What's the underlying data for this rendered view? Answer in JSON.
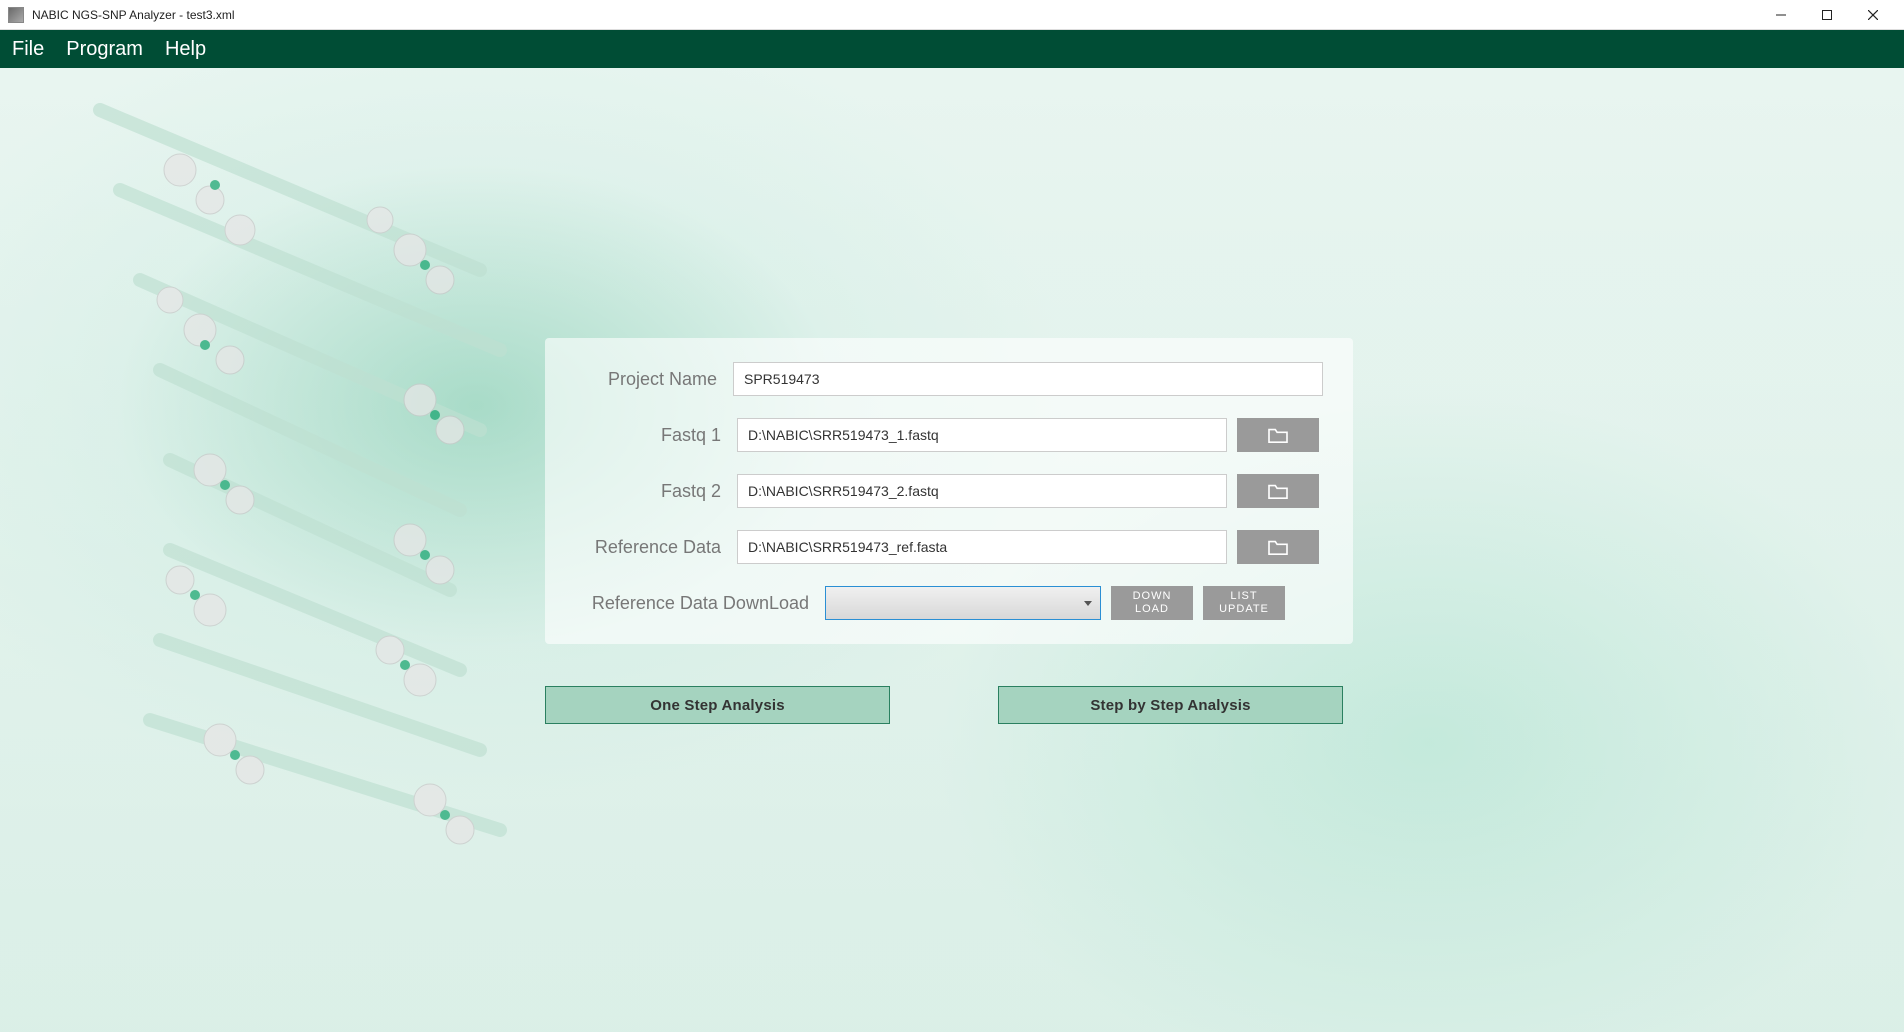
{
  "window": {
    "title": "NABIC NGS-SNP Analyzer - test3.xml"
  },
  "menubar": {
    "file": "File",
    "program": "Program",
    "help": "Help"
  },
  "form": {
    "project_name_label": "Project Name",
    "project_name_value": "SPR519473",
    "fastq1_label": "Fastq 1",
    "fastq1_value": "D:\\NABIC\\SRR519473_1.fastq",
    "fastq2_label": "Fastq 2",
    "fastq2_value": "D:\\NABIC\\SRR519473_2.fastq",
    "refdata_label": "Reference Data",
    "refdata_value": "D:\\NABIC\\SRR519473_ref.fasta",
    "refdl_label": "Reference Data DownLoad",
    "refdl_selected": "",
    "download_btn": "DOWN\nLOAD",
    "listupdate_btn": "LIST\nUPDATE"
  },
  "actions": {
    "one_step": "One Step Analysis",
    "step_by_step": "Step by Step Analysis"
  }
}
